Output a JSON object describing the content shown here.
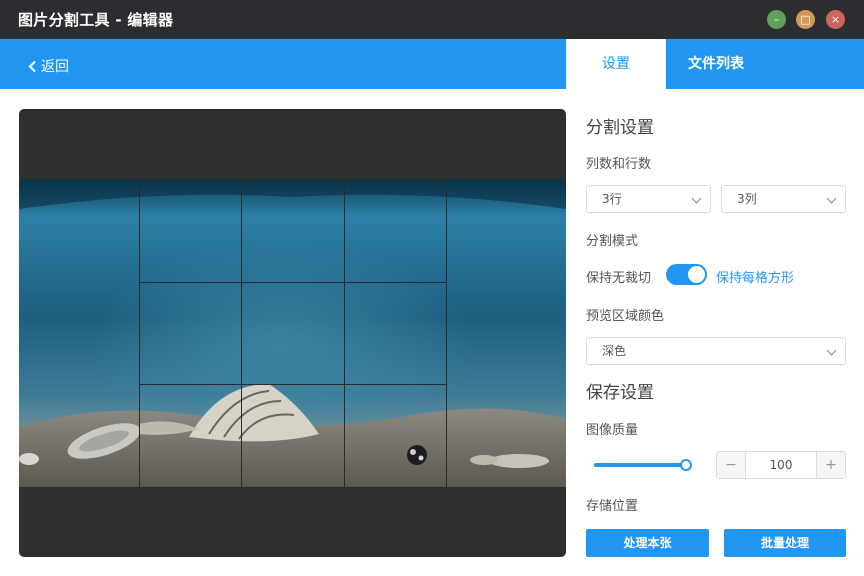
{
  "window": {
    "title": "图片分割工具 - 编辑器",
    "min_symbol": "–",
    "max_symbol": "□",
    "close_symbol": "×"
  },
  "nav": {
    "back_label": "返回",
    "tabs": [
      {
        "label": "设置"
      },
      {
        "label": "文件列表"
      }
    ]
  },
  "preview": {
    "grid_rows": 3,
    "grid_cols": 3
  },
  "split_settings": {
    "title": "分割设置",
    "rows_cols_label": "列数和行数",
    "rows_value": "3行",
    "cols_value": "3列",
    "mode_label": "分割模式",
    "mode_off_label": "保持无裁切",
    "mode_on_label": "保持每格方形",
    "preview_color_label": "预览区域颜色",
    "preview_color_value": "深色"
  },
  "save_settings": {
    "title": "保存设置",
    "quality_label": "图像质量",
    "quality_value": "100",
    "quality_fraction": 1.0,
    "minus_symbol": "−",
    "plus_symbol": "+",
    "location_label": "存储位置",
    "process_one_label": "处理本张",
    "batch_label": "批量处理"
  },
  "colors": {
    "accent": "#2196f3",
    "titlebar": "#2b2d30",
    "preview_bg": "#2e2f31"
  }
}
